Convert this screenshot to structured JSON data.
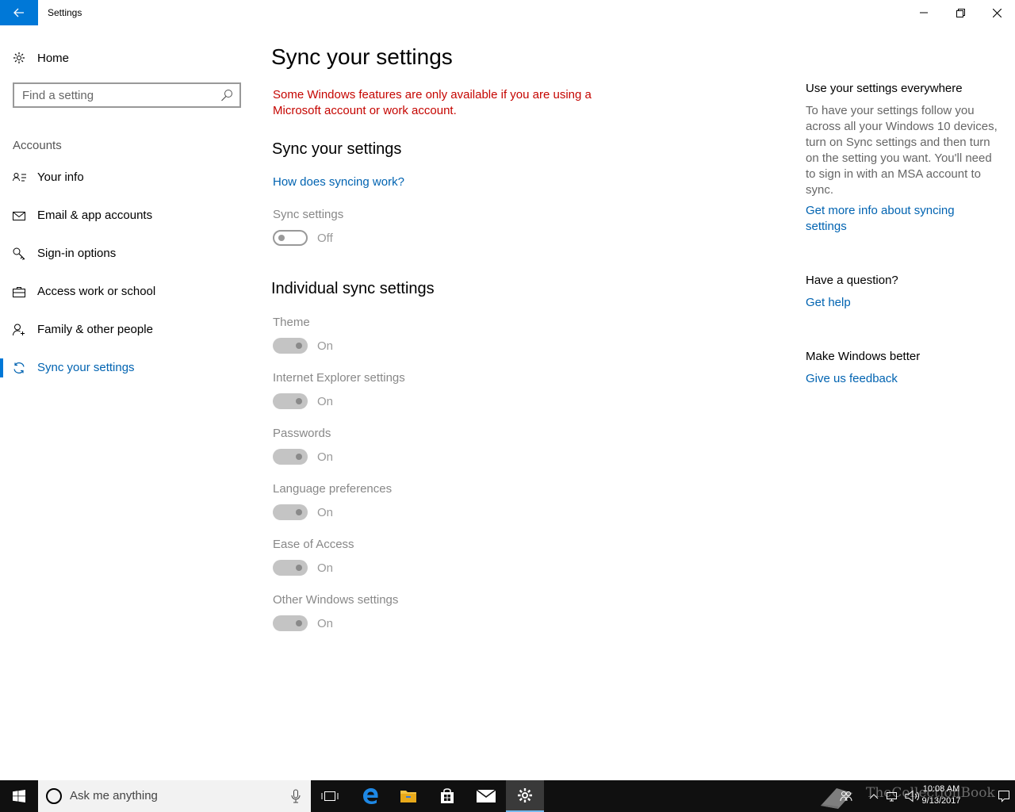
{
  "window": {
    "title": "Settings"
  },
  "sidebar": {
    "home_label": "Home",
    "search_placeholder": "Find a setting",
    "section_label": "Accounts",
    "items": [
      {
        "label": "Your info"
      },
      {
        "label": "Email & app accounts"
      },
      {
        "label": "Sign-in options"
      },
      {
        "label": "Access work or school"
      },
      {
        "label": "Family & other people"
      },
      {
        "label": "Sync your settings",
        "selected": true
      }
    ]
  },
  "main": {
    "title": "Sync your settings",
    "warning": "Some Windows features are only available if you are using a Microsoft account or work account.",
    "sync_heading": "Sync your settings",
    "how_link": "How does syncing work?",
    "sync_settings": {
      "label": "Sync settings",
      "state": "Off",
      "on": false
    },
    "individual_heading": "Individual sync settings",
    "individual": [
      {
        "label": "Theme",
        "state": "On"
      },
      {
        "label": "Internet Explorer settings",
        "state": "On"
      },
      {
        "label": "Passwords",
        "state": "On"
      },
      {
        "label": "Language preferences",
        "state": "On"
      },
      {
        "label": "Ease of Access",
        "state": "On"
      },
      {
        "label": "Other Windows settings",
        "state": "On"
      }
    ]
  },
  "aside": {
    "everywhere_heading": "Use your settings everywhere",
    "everywhere_text": "To have your settings follow you across all your Windows 10 devices, turn on Sync settings and then turn on the setting you want. You'll need to sign in with an MSA account to sync.",
    "more_info_link": "Get more info about syncing settings",
    "question_heading": "Have a question?",
    "help_link": "Get help",
    "better_heading": "Make Windows better",
    "feedback_link": "Give us feedback"
  },
  "taskbar": {
    "search_text": "Ask me anything",
    "time": "10:08 AM",
    "date": "9/13/2017",
    "watermark": "TheCollectionBook"
  },
  "colors": {
    "accent": "#0078d7",
    "link": "#0063b1",
    "warning": "#c50500",
    "taskbar": "#101010"
  }
}
